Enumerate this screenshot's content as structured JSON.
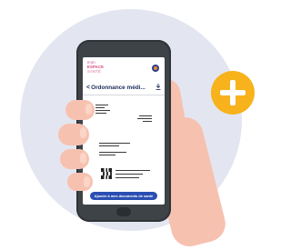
{
  "app": {
    "logo_line1": "mon",
    "logo_line2": "ESPACE",
    "logo_line3": "SANTÉ"
  },
  "screen": {
    "back_symbol": "<",
    "title": "Ordonnance médi...",
    "add_button_label": "Ajouter à mes documents de santé"
  },
  "colors": {
    "background_circle": "#e3e6f1",
    "plus_badge": "#f7b21c",
    "skin": "#f7c1b0",
    "phone_body": "#3e4348",
    "primary_button": "#2a4fb3",
    "logo_pink": "#d63d78",
    "title_navy": "#1d2b59"
  },
  "icons": {
    "badge": "plus-icon",
    "profile": "profile-icon",
    "download": "download-icon"
  }
}
